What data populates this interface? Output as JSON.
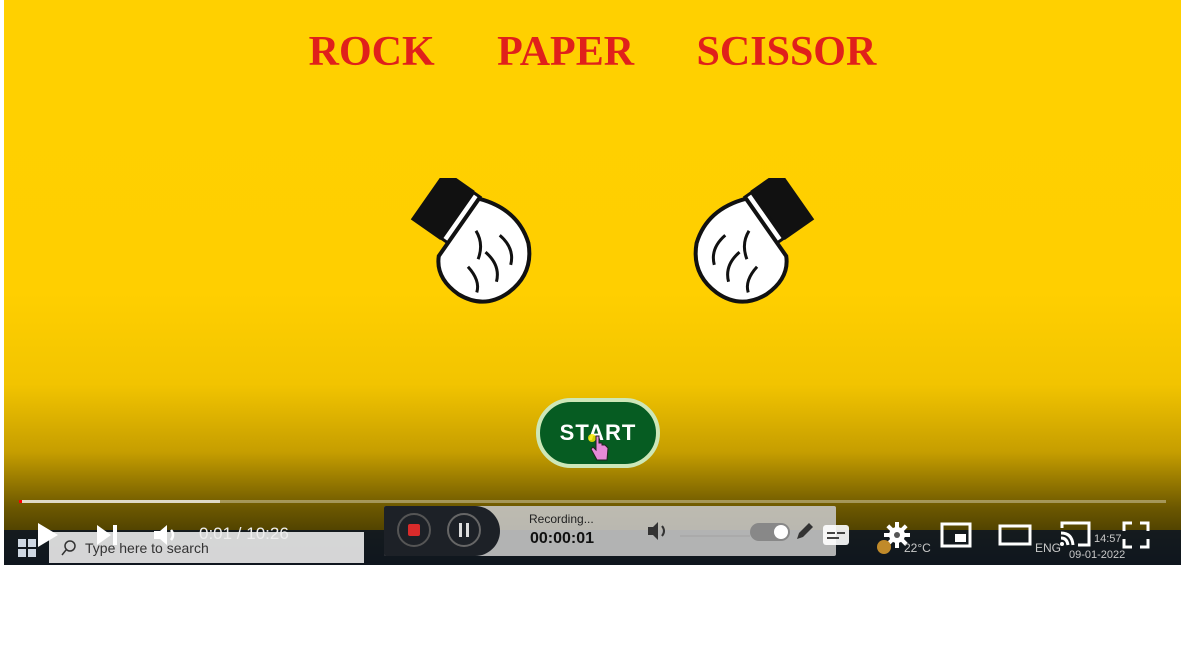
{
  "game": {
    "title_words": [
      "ROCK",
      "PAPER",
      "SCISSOR"
    ],
    "start_label": "START"
  },
  "player": {
    "current_time": "0:01",
    "duration": "10:26",
    "time_display": "0:01 / 10:26",
    "progress_fraction": 0.0016,
    "buffered_fraction": 0.175
  },
  "recorder": {
    "status": "Recording...",
    "elapsed": "00:00:01"
  },
  "taskbar": {
    "search_placeholder": "Type here to search",
    "weather": "22°C",
    "language": "ENG",
    "clock": "14:57",
    "date": "09-01-2022"
  },
  "icons": {
    "play": "play-icon",
    "next": "next-icon",
    "volume": "volume-icon",
    "settings": "gear-icon",
    "miniplayer": "miniplayer-icon",
    "theater": "theater-mode-icon",
    "cast": "cast-icon",
    "fullscreen": "fullscreen-icon"
  },
  "colors": {
    "background": "#ffd000",
    "title": "#e0201b",
    "start_button": "#065c22",
    "progress": "#ff0000"
  }
}
